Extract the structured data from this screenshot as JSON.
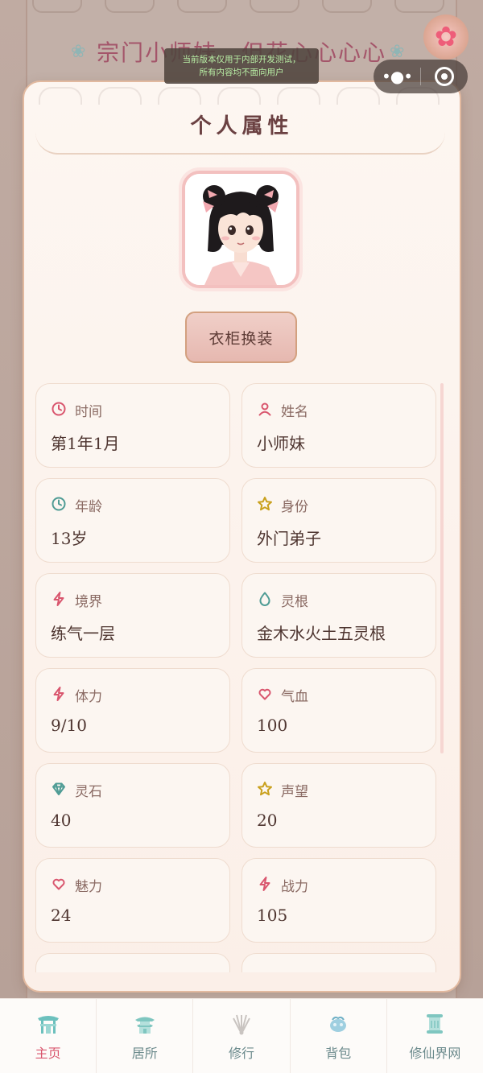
{
  "background": {
    "title": "宗门小师妹，但花心心心心"
  },
  "dev_notice": {
    "line1": "当前版本仅用于内部开发测试，",
    "line2": "所有内容均不面向用户"
  },
  "capsule": {
    "more_icon": "more-dots-icon",
    "close_icon": "target-icon"
  },
  "panel": {
    "title": "个人属性",
    "wardrobe_button": "衣柜换装"
  },
  "attributes": [
    {
      "key": "time",
      "label": "时间",
      "value": "第1年1月",
      "icon": "clock-icon",
      "color": "#d9566e"
    },
    {
      "key": "name",
      "label": "姓名",
      "value": "小师妹",
      "icon": "user-icon",
      "color": "#d9566e"
    },
    {
      "key": "age",
      "label": "年龄",
      "value": "13岁",
      "icon": "clock-icon",
      "color": "#4f9c95"
    },
    {
      "key": "identity",
      "label": "身份",
      "value": "外门弟子",
      "icon": "star-icon",
      "color": "#c9a01c"
    },
    {
      "key": "realm",
      "label": "境界",
      "value": "练气一层",
      "icon": "lightning-icon",
      "color": "#d9566e"
    },
    {
      "key": "spirit_root",
      "label": "灵根",
      "value": "金木水火土五灵根",
      "icon": "droplet-icon",
      "color": "#4f9c95"
    },
    {
      "key": "stamina",
      "label": "体力",
      "value": "9/10",
      "icon": "lightning-icon",
      "color": "#d9566e"
    },
    {
      "key": "hp",
      "label": "气血",
      "value": "100",
      "icon": "heart-icon",
      "color": "#d9566e"
    },
    {
      "key": "spirit_stones",
      "label": "灵石",
      "value": "40",
      "icon": "gem-icon",
      "color": "#4f9c95"
    },
    {
      "key": "reputation",
      "label": "声望",
      "value": "20",
      "icon": "star-icon",
      "color": "#c9a01c"
    },
    {
      "key": "charm",
      "label": "魅力",
      "value": "24",
      "icon": "heart-icon",
      "color": "#d9566e"
    },
    {
      "key": "combat",
      "label": "战力",
      "value": "105",
      "icon": "lightning-icon",
      "color": "#d9566e"
    }
  ],
  "tabs": [
    {
      "label": "主页",
      "icon": "gate-icon",
      "active": true
    },
    {
      "label": "居所",
      "icon": "pavilion-icon",
      "active": false
    },
    {
      "label": "修行",
      "icon": "sword-icon",
      "active": false
    },
    {
      "label": "背包",
      "icon": "pouch-icon",
      "active": false
    },
    {
      "label": "修仙界网",
      "icon": "scroll-icon",
      "active": false
    }
  ],
  "colors": {
    "accent_pink": "#d9566e",
    "accent_teal": "#4f9c95",
    "accent_gold": "#c9a01c",
    "panel_border": "#e2b99f"
  }
}
